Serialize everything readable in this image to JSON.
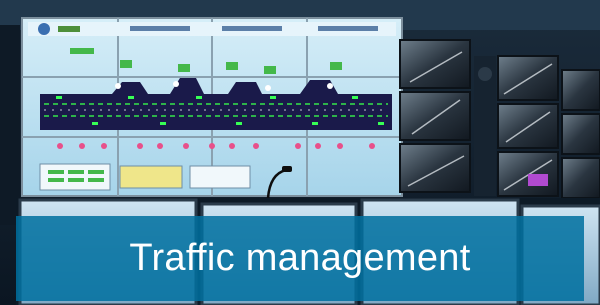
{
  "banner": {
    "title": "Traffic management"
  },
  "colors": {
    "banner_overlay": "#0070a0",
    "wall_screen": "#b9dff2",
    "tunnel_map": "#1a1a4a"
  }
}
